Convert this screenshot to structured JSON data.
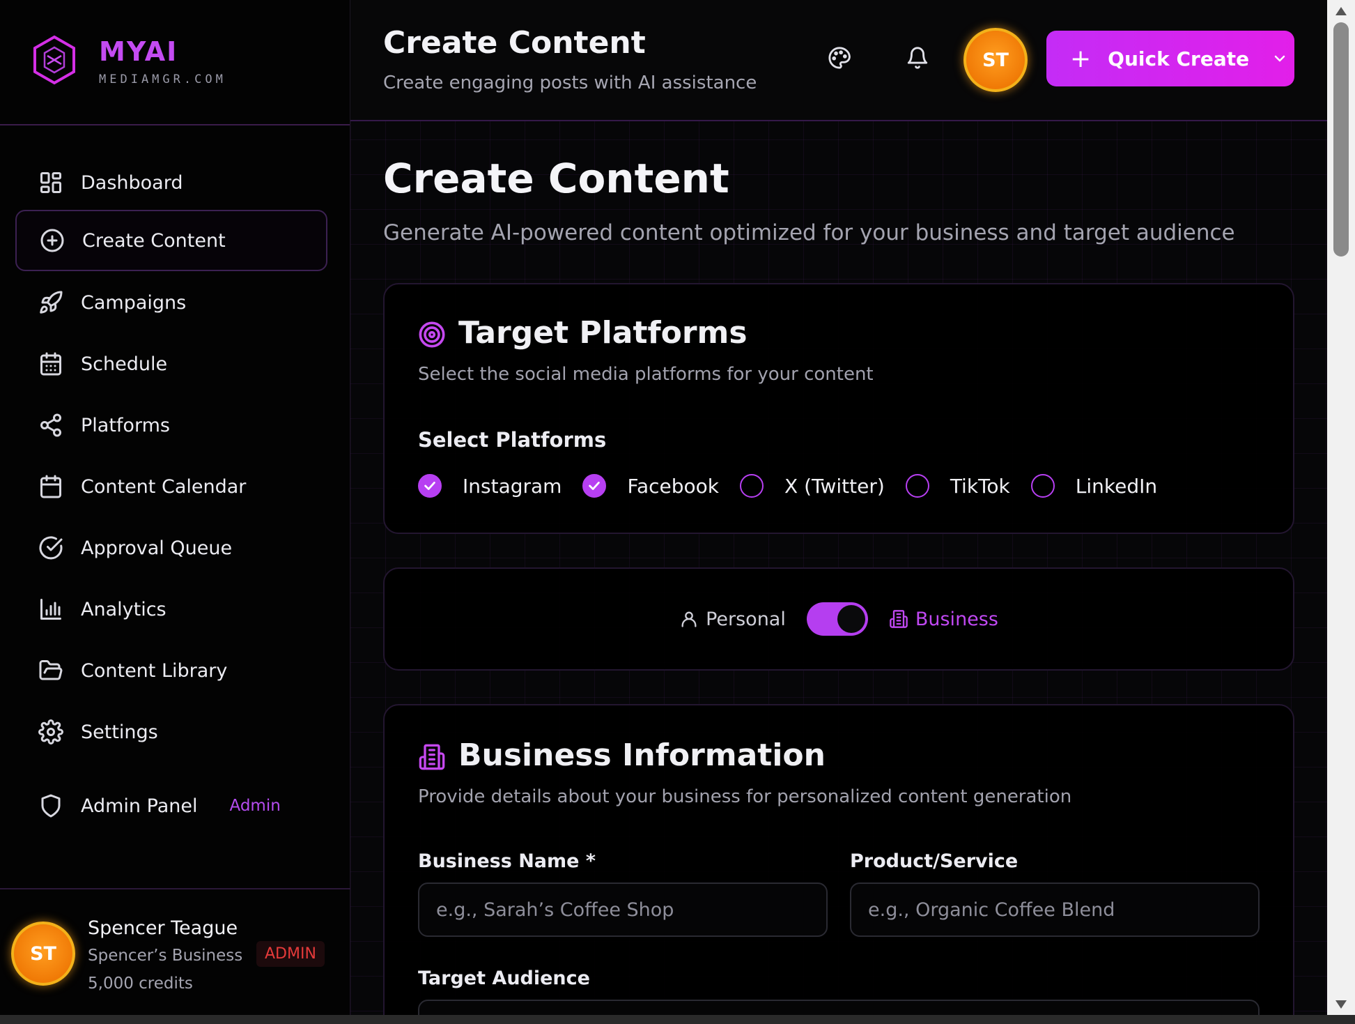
{
  "brand": {
    "name": "MYAI",
    "domain": "MEDIAMGR.COM"
  },
  "sidebar": {
    "items": [
      {
        "label": "Dashboard",
        "icon": "dashboard-icon"
      },
      {
        "label": "Create Content",
        "icon": "plus-circle-icon",
        "active": true
      },
      {
        "label": "Campaigns",
        "icon": "rocket-icon"
      },
      {
        "label": "Schedule",
        "icon": "calendar-grid-icon"
      },
      {
        "label": "Platforms",
        "icon": "share-icon"
      },
      {
        "label": "Content Calendar",
        "icon": "calendar-icon"
      },
      {
        "label": "Approval Queue",
        "icon": "check-circle-icon"
      },
      {
        "label": "Analytics",
        "icon": "bar-chart-icon"
      },
      {
        "label": "Content Library",
        "icon": "folder-icon"
      },
      {
        "label": "Settings",
        "icon": "gear-icon"
      },
      {
        "label": "Admin Panel",
        "icon": "shield-icon",
        "tag": "Admin"
      }
    ]
  },
  "user": {
    "initials": "ST",
    "name": "Spencer Teague",
    "business": "Spencer’s Business",
    "role": "ADMIN",
    "credits": "5,000 credits"
  },
  "header": {
    "title": "Create Content",
    "subtitle": "Create engaging posts with AI assistance",
    "quick_create_label": "Quick Create"
  },
  "page": {
    "title": "Create Content",
    "subtitle": "Generate AI-powered content optimized for your business and target audience"
  },
  "target_platforms": {
    "title": "Target Platforms",
    "subtitle": "Select the social media platforms for your content",
    "select_label": "Select Platforms",
    "platforms": [
      {
        "label": "Instagram",
        "checked": true
      },
      {
        "label": "Facebook",
        "checked": true
      },
      {
        "label": "X (Twitter)",
        "checked": false
      },
      {
        "label": "TikTok",
        "checked": false
      },
      {
        "label": "LinkedIn",
        "checked": false
      }
    ]
  },
  "mode_toggle": {
    "personal_label": "Personal",
    "business_label": "Business",
    "business_selected": true
  },
  "business_info": {
    "title": "Business Information",
    "subtitle": "Provide details about your business for personalized content generation",
    "business_name_label": "Business Name *",
    "business_name_placeholder": "e.g., Sarah’s Coffee Shop",
    "product_label": "Product/Service",
    "product_placeholder": "e.g., Organic Coffee Blend",
    "audience_label": "Target Audience"
  },
  "colors": {
    "accent": "#b73ff2",
    "brand_gradient_start": "#c42cf6",
    "brand_gradient_end": "#e21fe9",
    "avatar": "#f07a06",
    "admin_badge": "#e53a3a"
  }
}
